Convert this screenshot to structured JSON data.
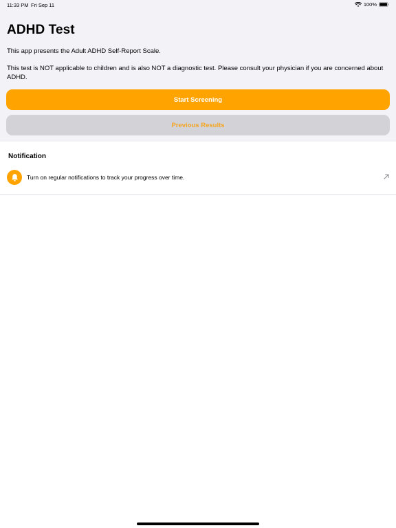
{
  "status_bar": {
    "time": "11:33 PM",
    "date": "Fri Sep 11",
    "battery": "100%",
    "icons": [
      "wifi-icon",
      "battery-icon"
    ]
  },
  "header": {
    "title": "ADHD Test",
    "intro": "This app presents the Adult ADHD Self-Report Scale.",
    "disclaimer": "This test is NOT applicable to children and is also NOT a diagnostic test. Please consult your physician if you are concerned about ADHD."
  },
  "actions": {
    "start_label": "Start Screening",
    "previous_label": "Previous Results"
  },
  "notification_section": {
    "header": "Notification",
    "row_text": "Turn on regular notifications to track your progress over time.",
    "row_icon": "bell-icon",
    "row_trailing_icon": "arrow-up-right-icon"
  },
  "colors": {
    "accent": "#ffa300",
    "background_top": "#f2f2f7",
    "secondary_button": "#d2d2d7"
  }
}
